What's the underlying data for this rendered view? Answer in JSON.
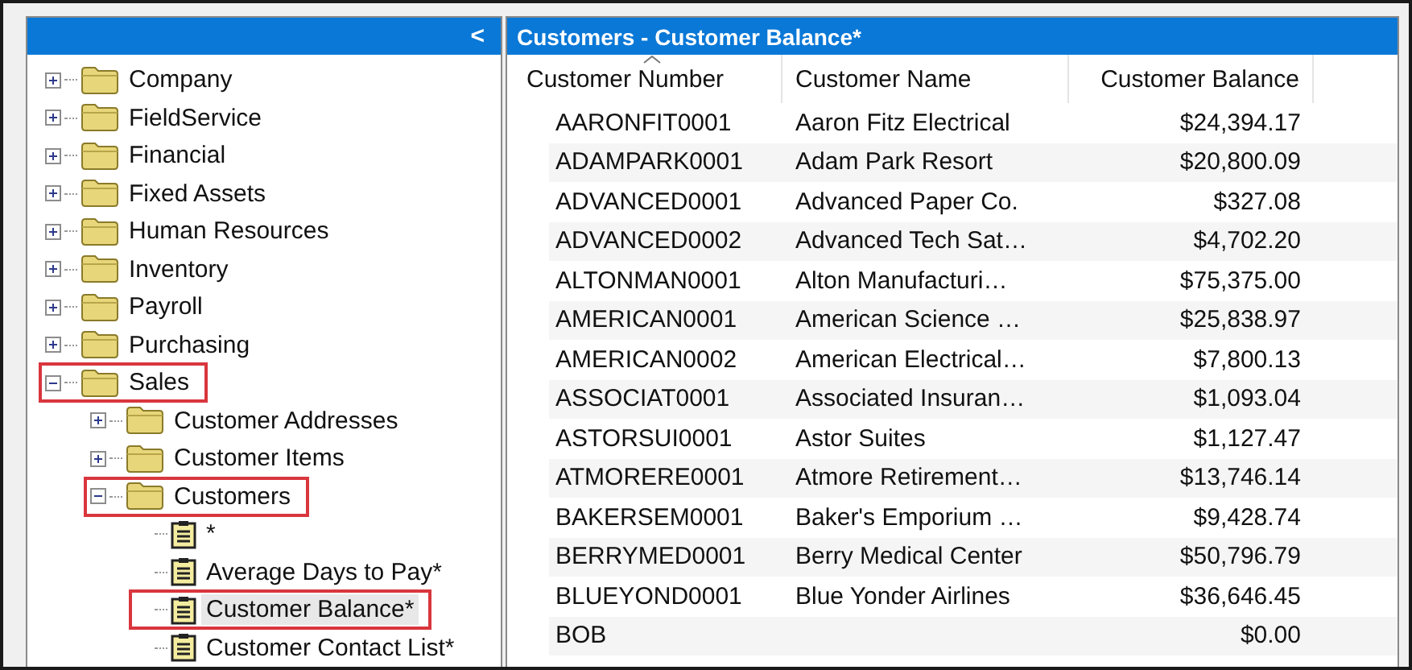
{
  "navigation_pane": {
    "collapse_button": "<",
    "tree": [
      {
        "label": "Company",
        "kind": "folder",
        "expanded": false,
        "highlighted": false,
        "selected": false
      },
      {
        "label": "FieldService",
        "kind": "folder",
        "expanded": false,
        "highlighted": false,
        "selected": false
      },
      {
        "label": "Financial",
        "kind": "folder",
        "expanded": false,
        "highlighted": false,
        "selected": false
      },
      {
        "label": "Fixed Assets",
        "kind": "folder",
        "expanded": false,
        "highlighted": false,
        "selected": false
      },
      {
        "label": "Human Resources",
        "kind": "folder",
        "expanded": false,
        "highlighted": false,
        "selected": false
      },
      {
        "label": "Inventory",
        "kind": "folder",
        "expanded": false,
        "highlighted": false,
        "selected": false
      },
      {
        "label": "Payroll",
        "kind": "folder",
        "expanded": false,
        "highlighted": false,
        "selected": false
      },
      {
        "label": "Purchasing",
        "kind": "folder",
        "expanded": false,
        "highlighted": false,
        "selected": false
      },
      {
        "label": "Sales",
        "kind": "folder",
        "expanded": true,
        "highlighted": true,
        "selected": false,
        "children": [
          {
            "label": "Customer Addresses",
            "kind": "folder",
            "expanded": false,
            "highlighted": false,
            "selected": false
          },
          {
            "label": "Customer Items",
            "kind": "folder",
            "expanded": false,
            "highlighted": false,
            "selected": false
          },
          {
            "label": "Customers",
            "kind": "folder",
            "expanded": true,
            "highlighted": true,
            "selected": false,
            "children": [
              {
                "label": "*",
                "kind": "report",
                "highlighted": false,
                "selected": false
              },
              {
                "label": "Average Days to Pay*",
                "kind": "report",
                "highlighted": false,
                "selected": false
              },
              {
                "label": "Customer Balance*",
                "kind": "report",
                "highlighted": true,
                "selected": true
              },
              {
                "label": "Customer Contact List*",
                "kind": "report",
                "highlighted": false,
                "selected": false
              }
            ]
          }
        ]
      }
    ]
  },
  "list_view": {
    "title": "Customers - Customer Balance*",
    "columns": [
      {
        "label": "Customer Number",
        "kind": "text",
        "sorted": true
      },
      {
        "label": "Customer Name",
        "kind": "text",
        "sorted": false
      },
      {
        "label": "Customer Balance",
        "kind": "amount",
        "sorted": false
      }
    ],
    "rows": [
      [
        "AARONFIT0001",
        "Aaron Fitz Electrical",
        "$24,394.17"
      ],
      [
        "ADAMPARK0001",
        "Adam Park Resort",
        "$20,800.09"
      ],
      [
        "ADVANCED0001",
        "Advanced Paper Co.",
        "$327.08"
      ],
      [
        "ADVANCED0002",
        "Advanced Tech Sat…",
        "$4,702.20"
      ],
      [
        "ALTONMAN0001",
        "Alton Manufacturi…",
        "$75,375.00"
      ],
      [
        "AMERICAN0001",
        "American Science …",
        "$25,838.97"
      ],
      [
        "AMERICAN0002",
        "American Electrical…",
        "$7,800.13"
      ],
      [
        "ASSOCIAT0001",
        "Associated Insuran…",
        "$1,093.04"
      ],
      [
        "ASTORSUI0001",
        "Astor Suites",
        "$1,127.47"
      ],
      [
        "ATMORERE0001",
        "Atmore Retirement…",
        "$13,746.14"
      ],
      [
        "BAKERSEM0001",
        "Baker's Emporium …",
        "$9,428.74"
      ],
      [
        "BERRYMED0001",
        "Berry Medical Center",
        "$50,796.79"
      ],
      [
        "BLUEYOND0001",
        "Blue Yonder Airlines",
        "$36,646.45"
      ],
      [
        "BOB",
        "",
        "$0.00"
      ]
    ]
  }
}
